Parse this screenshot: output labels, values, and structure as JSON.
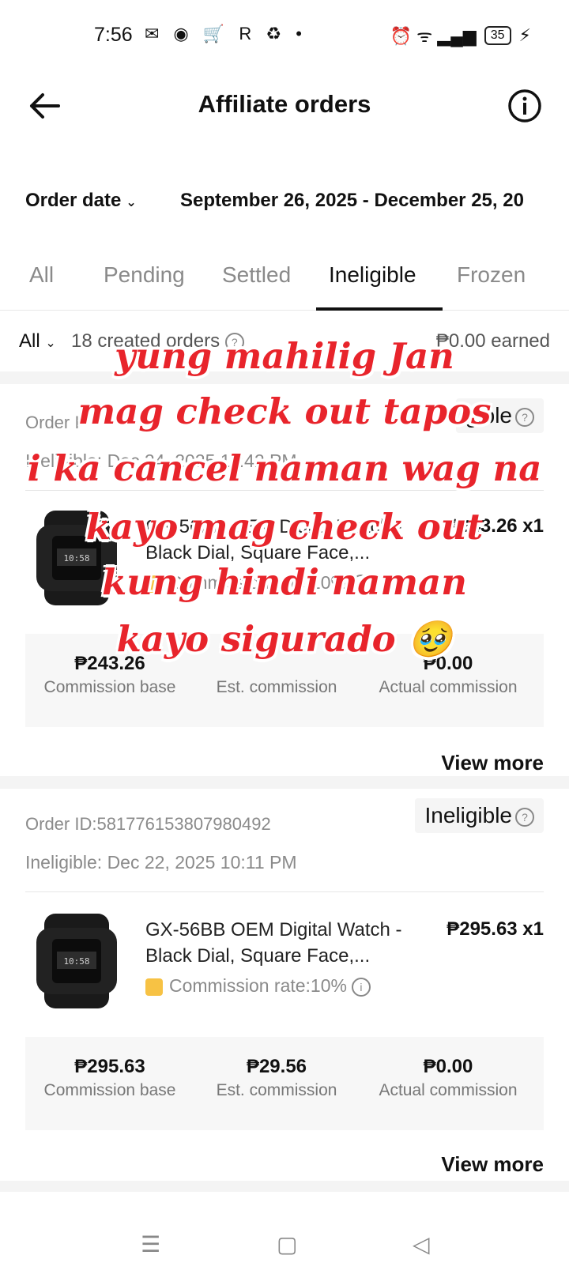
{
  "status_bar": {
    "time": "7:56",
    "left_icons": "✉ ◉ 🛒 R ♻ •",
    "right_icons": "⏰ ᯤ ▂▄▆",
    "battery": "35",
    "charging": "⚡"
  },
  "header": {
    "title": "Affiliate orders"
  },
  "filters": {
    "order_date_label": "Order date",
    "date_range": "September 26, 2025 - December 25, 20"
  },
  "tabs": [
    {
      "label": "All"
    },
    {
      "label": "Pending"
    },
    {
      "label": "Settled"
    },
    {
      "label": "Ineligible",
      "active": true
    },
    {
      "label": "Frozen"
    }
  ],
  "summary": {
    "all_label": "All",
    "created_orders": "18 created orders",
    "earned": "₱0.00 earned"
  },
  "orders": [
    {
      "order_id": "Order I",
      "status": "Ineligible",
      "status_visible": "gible",
      "ineligible_date": "Ineligible: Dec 24, 2025 11:42 PM",
      "product_name": "GX-56BB OEM Digital Watch - Black Dial, Square Face,...",
      "price": "₱243.26 x1",
      "commission_rate": "Commission rate:10%",
      "commission_base": "₱243.26",
      "commission_base_label": "Commission base",
      "est_commission": "",
      "est_commission_label": "Est. commission",
      "actual_commission": "₱0.00",
      "actual_commission_label": "Actual commission",
      "view_more": "View more"
    },
    {
      "order_id": "Order ID:581776153807980492",
      "status": "Ineligible",
      "ineligible_date": "Ineligible: Dec 22, 2025 10:11 PM",
      "product_name": "GX-56BB OEM Digital Watch - Black Dial, Square Face,...",
      "price": "₱295.63 x1",
      "commission_rate": "Commission rate:10%",
      "commission_base": "₱295.63",
      "commission_base_label": "Commission base",
      "est_commission": "₱29.56",
      "est_commission_label": "Est. commission",
      "actual_commission": "₱0.00",
      "actual_commission_label": "Actual commission",
      "view_more": "View more"
    }
  ],
  "caption_overlay": {
    "lines": [
      "yung mahilig Jan",
      "mag check out  tapos",
      "i ka cancel naman wag na",
      "kayo mag check out",
      "kung hindi naman",
      "kayo sigurado 🥹"
    ],
    "color": "#e8242b"
  },
  "nav_bar": {
    "menu": "☰",
    "home": "▢",
    "back": "◁"
  }
}
